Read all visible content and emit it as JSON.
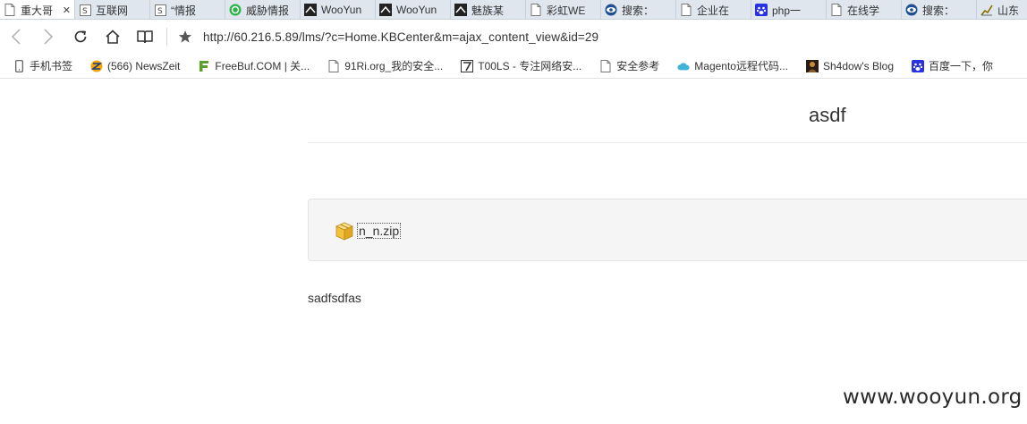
{
  "tabs": [
    {
      "label": "重大哥",
      "icon": "page-icon",
      "active": true,
      "close": "✕"
    },
    {
      "label": "互联网",
      "icon": "s-favicon"
    },
    {
      "label": "“情报",
      "icon": "s-favicon"
    },
    {
      "label": "威胁情报",
      "icon": "green-favicon"
    },
    {
      "label": "WooYun",
      "icon": "wooyun-favicon"
    },
    {
      "label": "WooYun",
      "icon": "wooyun-favicon"
    },
    {
      "label": "魅族某",
      "icon": "wooyun-favicon"
    },
    {
      "label": "彩虹WE",
      "icon": "page-icon"
    },
    {
      "label": "搜索：",
      "icon": "eye-favicon"
    },
    {
      "label": "企业在",
      "icon": "page-icon"
    },
    {
      "label": "php一",
      "icon": "baidu-paw-icon"
    },
    {
      "label": "在线学",
      "icon": "page-icon"
    },
    {
      "label": "搜索：",
      "icon": "eye-favicon"
    },
    {
      "label": "山东",
      "icon": "chart-favicon"
    }
  ],
  "toolbar": {
    "url": "http://60.216.5.89/lms/?c=Home.KBCenter&m=ajax_content_view&id=29"
  },
  "bookmarks": [
    {
      "label": "手机书签",
      "icon": "phone-icon"
    },
    {
      "label": "(566) NewsZeit",
      "icon": "newszeit-icon"
    },
    {
      "label": "FreeBuf.COM | 关...",
      "icon": "freebuf-icon"
    },
    {
      "label": "91Ri.org_我的安全...",
      "icon": "page-icon"
    },
    {
      "label": "T00LS - 专注网络安...",
      "icon": "tools-icon"
    },
    {
      "label": "安全参考",
      "icon": "page-icon"
    },
    {
      "label": "Magento远程代码...",
      "icon": "cloud-icon"
    },
    {
      "label": "Sh4dow's Blog",
      "icon": "avatar-icon"
    },
    {
      "label": "百度一下，你",
      "icon": "baidu-paw-icon"
    }
  ],
  "page": {
    "title": "asdf",
    "attachment": "n_n.zip",
    "body": "sadfsdfas",
    "watermark": "www.wooyun.org"
  }
}
